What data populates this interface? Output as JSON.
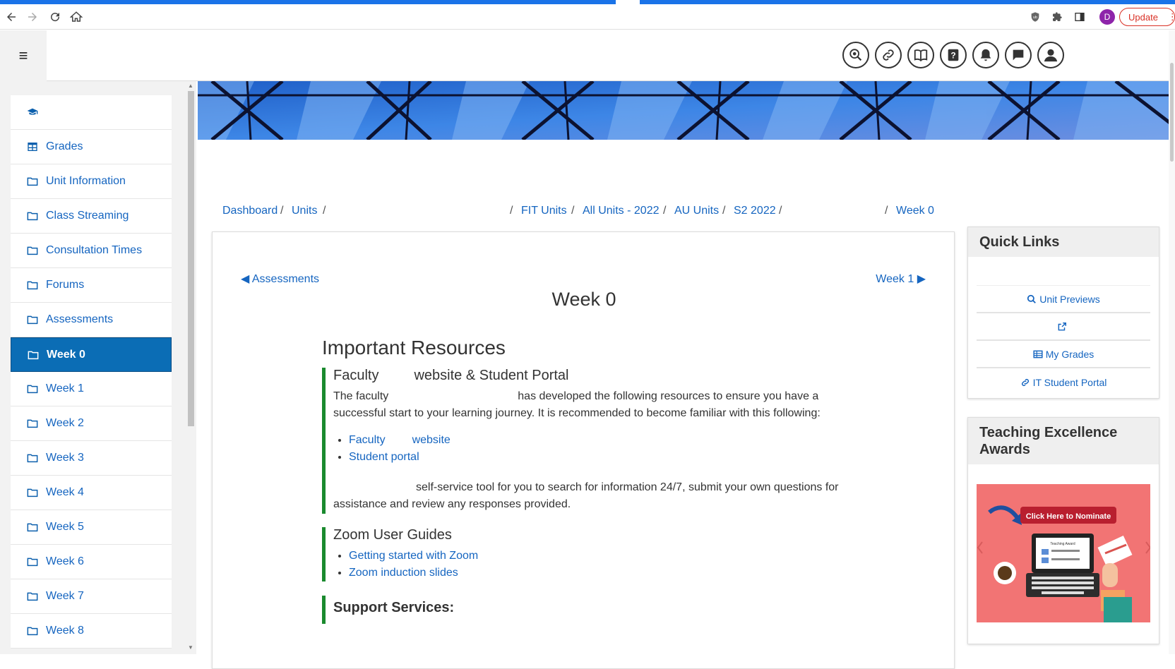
{
  "browser": {
    "profile_initial": "D",
    "update_label": "Update"
  },
  "header": {
    "menu_icon": "hamburger-icon",
    "icons": [
      "accessibility-icon",
      "link-icon",
      "library-icon",
      "help-icon",
      "bell-icon",
      "chat-icon",
      "user-icon"
    ]
  },
  "sidebar": {
    "items": [
      {
        "label": "",
        "icon": "graduation-cap-icon"
      },
      {
        "label": "Grades",
        "icon": "table-icon"
      },
      {
        "label": "Unit Information",
        "icon": "folder-icon"
      },
      {
        "label": "Class Streaming",
        "icon": "folder-icon"
      },
      {
        "label": "Consultation Times",
        "icon": "folder-icon"
      },
      {
        "label": "Forums",
        "icon": "folder-icon"
      },
      {
        "label": "Assessments",
        "icon": "folder-icon"
      },
      {
        "label": "Week 0",
        "icon": "folder-icon",
        "active": true
      },
      {
        "label": "Week 1",
        "icon": "folder-icon"
      },
      {
        "label": "Week 2",
        "icon": "folder-icon"
      },
      {
        "label": "Week 3",
        "icon": "folder-icon"
      },
      {
        "label": "Week 4",
        "icon": "folder-icon"
      },
      {
        "label": "Week 5",
        "icon": "folder-icon"
      },
      {
        "label": "Week 6",
        "icon": "folder-icon"
      },
      {
        "label": "Week 7",
        "icon": "folder-icon"
      },
      {
        "label": "Week 8",
        "icon": "folder-icon"
      }
    ]
  },
  "breadcrumb": {
    "dashboard": "Dashboard",
    "units": "Units",
    "fit_units": "FIT Units",
    "all_units": "All Units - 2022",
    "au_units": "AU Units",
    "s2": "S2 2022",
    "current": "Week 0",
    "sep": "/"
  },
  "main": {
    "prev_label": "◀ Assessments",
    "next_label": "Week 1 ▶",
    "title": "Week 0",
    "resources_heading": "Important Resources",
    "faculty": {
      "heading_a": "Faculty",
      "heading_b": "website & Student Portal",
      "text_a": "The faculty",
      "text_b": "has developed the following resources to ensure you have a",
      "text_c": "successful start to your learning journey. It is recommended to become familiar with this following:",
      "link1_a": "Faculty",
      "link1_b": "website",
      "link2": "Student portal"
    },
    "selfservice": {
      "text_a": "self-service tool for you to search for information 24/7, submit your own questions for",
      "text_b": "assistance and review any responses provided."
    },
    "zoom": {
      "heading": "Zoom User Guides",
      "link1": "Getting started with Zoom",
      "link2": "Zoom induction slides"
    },
    "support_heading": "Support Services:"
  },
  "quick_links": {
    "heading": "Quick Links",
    "items": [
      "Unit Previews",
      "",
      "My Grades",
      "IT Student Portal"
    ]
  },
  "awards": {
    "heading_line1": "Teaching Excellence",
    "heading_line2": "Awards",
    "banner_text": "Click Here to Nominate",
    "laptop_text": "Teaching Award"
  },
  "colors": {
    "accent": "#0b6db5",
    "link": "#1565c0",
    "green_rule": "#1a8a2e",
    "award_bg": "#f27474"
  }
}
